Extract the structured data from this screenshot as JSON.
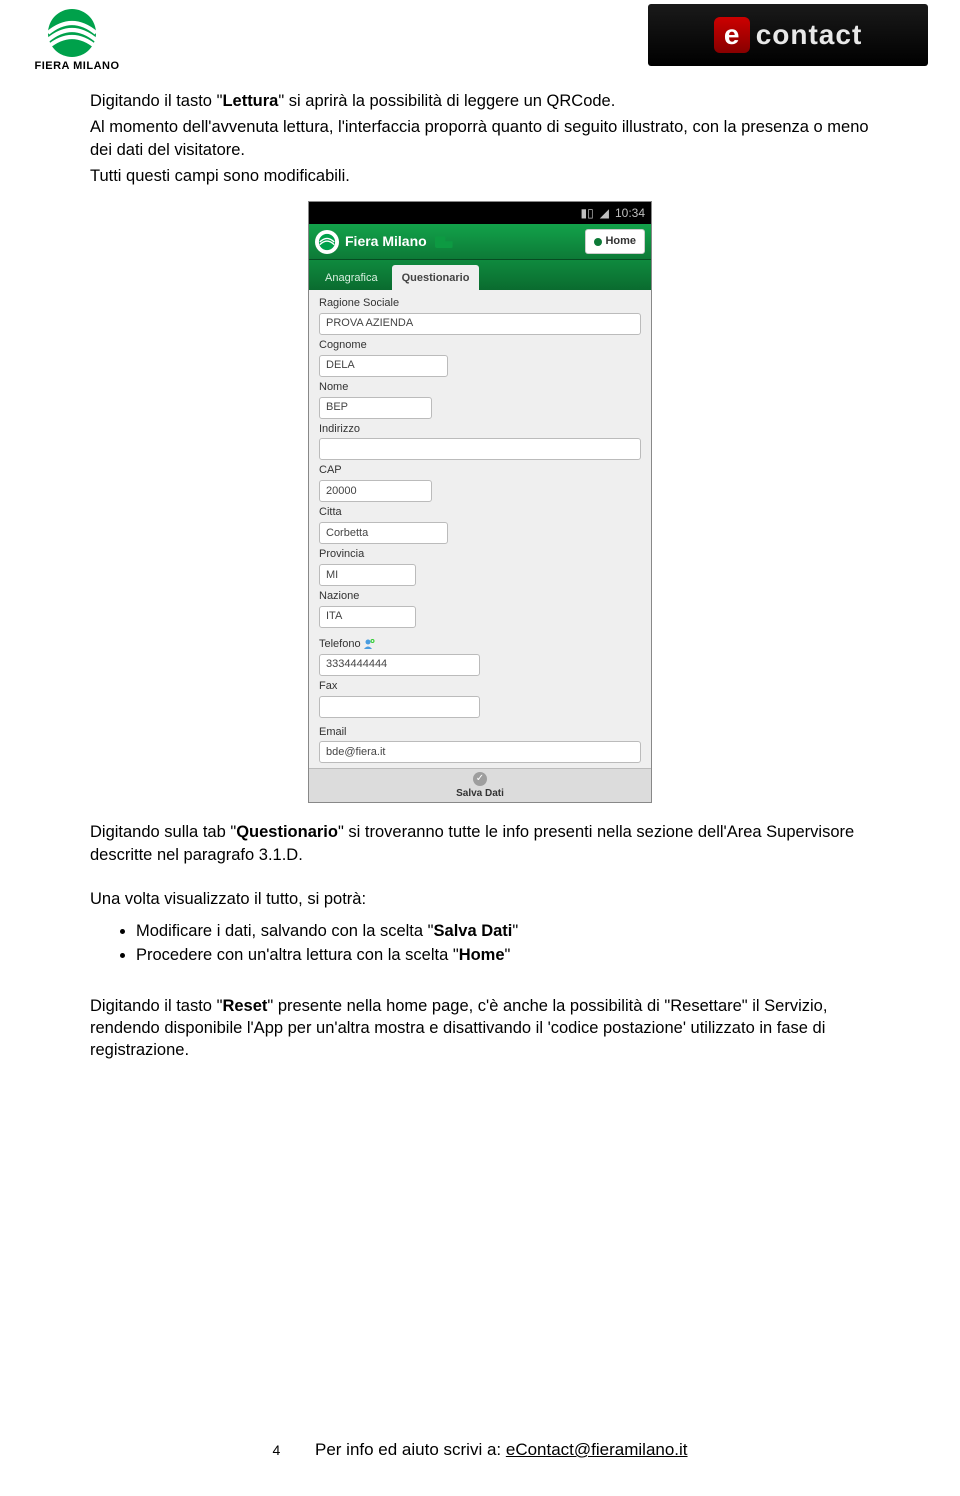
{
  "header": {
    "logo_left_text": "FIERA MILANO",
    "logo_right_e": "e",
    "logo_right_word": "contact"
  },
  "para1": {
    "t1": "Digitando il tasto \"",
    "b1": "Lettura",
    "t2": "\" si aprirà la possibilità di leggere un QRCode."
  },
  "para2": "Al momento dell'avvenuta lettura, l'interfaccia proporrà quanto di seguito illustrato, con la presenza o meno dei dati del visitatore.",
  "para3": "Tutti questi campi sono modificabili.",
  "phone": {
    "status_time": "10:34",
    "app_title": "Fiera Milano",
    "home_label": "Home",
    "tabs": {
      "anagrafica": "Anagrafica",
      "questionario": "Questionario"
    },
    "fields": [
      {
        "label": "Ragione Sociale",
        "value": "PROVA AZIENDA",
        "w": ""
      },
      {
        "label": "Cognome",
        "value": "DELA",
        "w": "w40"
      },
      {
        "label": "Nome",
        "value": "BEP",
        "w": "w35"
      },
      {
        "label": "Indirizzo",
        "value": "",
        "w": ""
      },
      {
        "label": "CAP",
        "value": "20000",
        "w": "w35"
      },
      {
        "label": "Citta",
        "value": "Corbetta",
        "w": "w40"
      },
      {
        "label": "Provincia",
        "value": "MI",
        "w": "w30"
      },
      {
        "label": "Nazione",
        "value": "ITA",
        "w": "w30"
      }
    ],
    "telefono_label": "Telefono",
    "telefono_value": "3334444444",
    "fax_label": "Fax",
    "email_label": "Email",
    "email_value": "bde@fiera.it",
    "salva": "Salva Dati"
  },
  "para4": {
    "t1": "Digitando sulla tab \"",
    "b1": "Questionario",
    "t2": "\" si troveranno tutte le info presenti nella sezione dell'Area Supervisore descritte nel paragrafo 3.1.D."
  },
  "para5": "Una volta visualizzato il tutto, si potrà:",
  "bullets": {
    "b1a": "Modificare i dati, salvando con la scelta \"",
    "b1b": "Salva Dati",
    "b1c": "\"",
    "b2a": "Procedere con un'altra lettura con la scelta \"",
    "b2b": "Home",
    "b2c": "\""
  },
  "para6": {
    "t1": "Digitando il tasto \"",
    "b1": "Reset",
    "t2": "\" presente nella home page, c'è anche la possibilità di \"Resettare\" il Servizio, rendendo disponibile l'App per un'altra mostra e disattivando il 'codice postazione' utilizzato in fase di registrazione."
  },
  "footer": {
    "page": "4",
    "text": "Per info ed aiuto scrivi a:  ",
    "email": "eContact@fieramilano.it"
  }
}
